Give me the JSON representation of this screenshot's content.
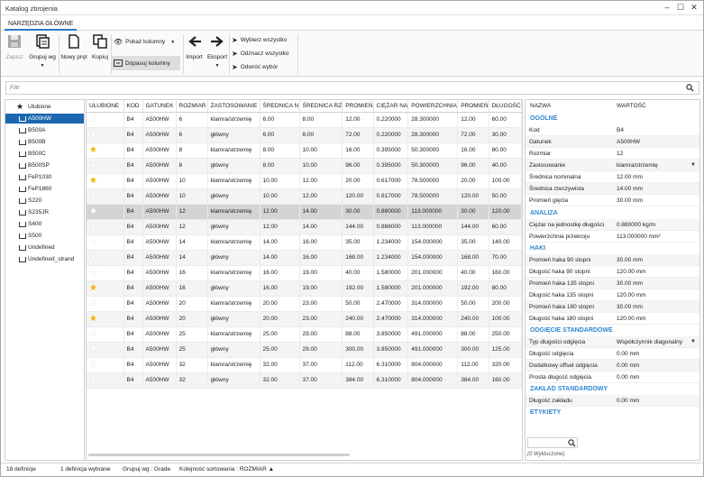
{
  "window": {
    "title": "Katalog zbrojenia"
  },
  "tab": "NARZĘDZIA GŁÓWNE",
  "ribbon": {
    "save": "Zapisz",
    "group_by": "Grupuj wg",
    "new_bar": "Nowy pręt",
    "copy": "Kopiuj",
    "show_columns": "Pokaż kolumny",
    "fit_columns": "Dopasuj kolumny",
    "import": "Import",
    "export": "Eksport",
    "select_all": "Wybierz wszystko",
    "deselect_all": "Odznacz wszystko",
    "invert": "Odwróć wybór"
  },
  "filter": {
    "placeholder": "Filtr"
  },
  "tree": {
    "favorites": "Ulubione",
    "items": [
      "A500HW",
      "B500A",
      "B500B",
      "B500C",
      "B500SP",
      "FeP1030",
      "FeP1860",
      "S220",
      "S235JR",
      "S400",
      "S500",
      "Undefined",
      "Undefined_strand"
    ],
    "selected": 0
  },
  "grid": {
    "columns": [
      "ULUBIONE",
      "KOD",
      "GATUNEK",
      "ROZMIAR",
      "ZASTOSOWANIE",
      "ŚREDNICA N",
      "ŚREDNICA RZ",
      "PROMIEŃ",
      "CIĘŻAR NA",
      "POWIERZCHNIA",
      "PROMIEŃ",
      "DŁUGOŚĆ"
    ],
    "selected_row": 6,
    "rows": [
      {
        "fav": false,
        "cells": [
          "B4",
          "A500HW",
          "6",
          "klamra/strzemię",
          "6.00",
          "8.00",
          "12.00",
          "0.220000",
          "28.300000",
          "12.00",
          "60.00"
        ]
      },
      {
        "fav": false,
        "cells": [
          "B4",
          "A500HW",
          "6",
          "główny",
          "6.00",
          "8.00",
          "72.00",
          "0.220000",
          "28.300000",
          "72.00",
          "30.00"
        ]
      },
      {
        "fav": true,
        "cells": [
          "B4",
          "A500HW",
          "8",
          "klamra/strzemię",
          "8.00",
          "10.00",
          "16.00",
          "0.395000",
          "50.300000",
          "16.00",
          "80.00"
        ]
      },
      {
        "fav": false,
        "cells": [
          "B4",
          "A500HW",
          "8",
          "główny",
          "8.00",
          "10.00",
          "96.00",
          "0.395000",
          "50.300000",
          "96.00",
          "40.00"
        ]
      },
      {
        "fav": true,
        "cells": [
          "B4",
          "A500HW",
          "10",
          "klamra/strzemię",
          "10.00",
          "12.00",
          "20.00",
          "0.617000",
          "78.500000",
          "20.00",
          "100.00"
        ]
      },
      {
        "fav": false,
        "cells": [
          "B4",
          "A500HW",
          "10",
          "główny",
          "10.00",
          "12.00",
          "120.00",
          "0.617000",
          "78.500000",
          "120.00",
          "50.00"
        ]
      },
      {
        "fav": false,
        "cells": [
          "B4",
          "A500HW",
          "12",
          "klamra/strzemię",
          "12.00",
          "14.00",
          "30.00",
          "0.880000",
          "113.000000",
          "30.00",
          "120.00"
        ]
      },
      {
        "fav": false,
        "cells": [
          "B4",
          "A500HW",
          "12",
          "główny",
          "12.00",
          "14.00",
          "144.00",
          "0.888000",
          "113.000000",
          "144.00",
          "60.00"
        ]
      },
      {
        "fav": false,
        "cells": [
          "B4",
          "A500HW",
          "14",
          "klamra/strzemię",
          "14.00",
          "16.00",
          "35.00",
          "1.234000",
          "154.000000",
          "35.00",
          "140.00"
        ]
      },
      {
        "fav": false,
        "cells": [
          "B4",
          "A500HW",
          "14",
          "główny",
          "14.00",
          "16.00",
          "168.00",
          "1.234000",
          "154.000000",
          "168.00",
          "70.00"
        ]
      },
      {
        "fav": false,
        "cells": [
          "B4",
          "A500HW",
          "16",
          "klamra/strzemię",
          "16.00",
          "19.00",
          "40.00",
          "1.580000",
          "201.000000",
          "40.00",
          "160.00"
        ]
      },
      {
        "fav": true,
        "cells": [
          "B4",
          "A500HW",
          "16",
          "główny",
          "16.00",
          "19.00",
          "192.00",
          "1.580000",
          "201.000000",
          "192.00",
          "80.00"
        ]
      },
      {
        "fav": false,
        "cells": [
          "B4",
          "A500HW",
          "20",
          "klamra/strzemię",
          "20.00",
          "23.00",
          "50.00",
          "2.470000",
          "314.000000",
          "50.00",
          "200.00"
        ]
      },
      {
        "fav": true,
        "cells": [
          "B4",
          "A500HW",
          "20",
          "główny",
          "20.00",
          "23.00",
          "240.00",
          "2.470000",
          "314.000000",
          "240.00",
          "100.00"
        ]
      },
      {
        "fav": false,
        "cells": [
          "B4",
          "A500HW",
          "25",
          "klamra/strzemię",
          "25.00",
          "29.00",
          "88.00",
          "3.850000",
          "491.000000",
          "88.00",
          "250.00"
        ]
      },
      {
        "fav": false,
        "cells": [
          "B4",
          "A500HW",
          "25",
          "główny",
          "25.00",
          "29.00",
          "300.00",
          "3.850000",
          "491.000000",
          "300.00",
          "125.00"
        ]
      },
      {
        "fav": false,
        "cells": [
          "B4",
          "A500HW",
          "32",
          "klamra/strzemię",
          "32.00",
          "37.00",
          "112.00",
          "6.310000",
          "804.000000",
          "112.00",
          "320.00"
        ]
      },
      {
        "fav": false,
        "cells": [
          "B4",
          "A500HW",
          "32",
          "główny",
          "32.00",
          "37.00",
          "384.00",
          "6.310000",
          "804.000000",
          "384.00",
          "160.00"
        ]
      }
    ]
  },
  "props": {
    "col_name": "NAZWA",
    "col_value": "WARTOŚĆ",
    "sections": [
      {
        "title": "OGÓLNE",
        "rows": [
          [
            "Kod",
            "B4"
          ],
          [
            "Gatunek",
            "A500HW"
          ],
          [
            "Rozmiar",
            "12"
          ],
          [
            "Zastosowanie",
            "klamra/strzemię"
          ],
          [
            "Średnica nominalna",
            "12.00 mm"
          ],
          [
            "Średnica rzeczywista",
            "14.00 mm"
          ],
          [
            "Promień gięcia",
            "30.00 mm"
          ]
        ]
      },
      {
        "title": "ANALIZA",
        "rows": [
          [
            "Ciężar na jednostkę długości",
            "0.880000 kg/m"
          ],
          [
            "Powierzchnia przekroju",
            "113.000000 mm²"
          ]
        ]
      },
      {
        "title": "HAKI",
        "rows": [
          [
            "Promień haka 90 stopni",
            "30.00 mm"
          ],
          [
            "Długość haka 90 stopni",
            "120.00 mm"
          ],
          [
            "Promień haka 135 stopni",
            "30.00 mm"
          ],
          [
            "Długość haka 135 stopni",
            "120.00 mm"
          ],
          [
            "Promień haka 180 stopni",
            "30.00 mm"
          ],
          [
            "Długość haka 180 stopni",
            "120.00 mm"
          ]
        ]
      },
      {
        "title": "ODGIĘCIE STANDARDOWE",
        "rows": [
          [
            "Typ długości odgięcia",
            "Współczynnik diagonalny"
          ],
          [
            "Długość odgięcia",
            "0.00 mm"
          ],
          [
            "Dodatkowy offset odgięcia",
            "0.00 mm"
          ],
          [
            "Prosta długość odgięcia",
            "0.00 mm"
          ]
        ]
      },
      {
        "title": "ZAKŁAD STANDARDOWY",
        "rows": [
          [
            "Długość zakładu",
            "0.00 mm"
          ]
        ]
      },
      {
        "title": "ETYKIETY",
        "rows": []
      }
    ],
    "excluded": "(0 Wykluczone)"
  },
  "status": {
    "count": "18 definicje",
    "selected": "1 definicja wybrane",
    "group": "Grupuj wg : Grade",
    "sort": "Kolejność sortowania : ROZMIAR ▲"
  }
}
